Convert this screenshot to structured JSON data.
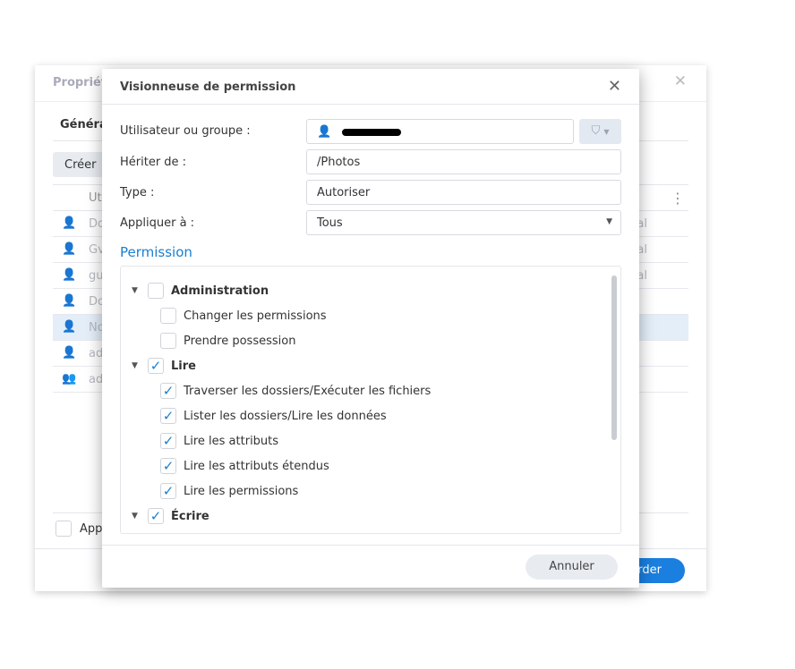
{
  "background_window": {
    "title": "Propriét",
    "tab": "Généra",
    "create_button": "Créer",
    "column_header": "Ut",
    "rows": [
      {
        "name": "Do",
        "right": "al",
        "icon": "user"
      },
      {
        "name": "Gv",
        "right": "al",
        "icon": "user"
      },
      {
        "name": "gu",
        "right": "al",
        "icon": "user"
      },
      {
        "name": "Do",
        "right": "",
        "icon": "user"
      },
      {
        "name": "No",
        "right": "",
        "icon": "user"
      },
      {
        "name": "ad",
        "right": "",
        "icon": "user"
      },
      {
        "name": "ad",
        "right": "",
        "icon": "group"
      }
    ],
    "apply_checkbox_label": "App",
    "save_button": "rder"
  },
  "dialog": {
    "title": "Visionneuse de permission",
    "fields": {
      "user_label": "Utilisateur ou groupe :",
      "inherit_label": "Hériter de :",
      "inherit_value": "/Photos",
      "type_label": "Type :",
      "type_value": "Autoriser",
      "apply_label": "Appliquer à :",
      "apply_value": "Tous"
    },
    "section": "Permission",
    "permissions": [
      {
        "label": "Administration",
        "group": true,
        "checked": false
      },
      {
        "label": "Changer les permissions",
        "group": false,
        "checked": false
      },
      {
        "label": "Prendre possession",
        "group": false,
        "checked": false
      },
      {
        "label": "Lire",
        "group": true,
        "checked": true
      },
      {
        "label": "Traverser les dossiers/Exécuter les fichiers",
        "group": false,
        "checked": true
      },
      {
        "label": "Lister les dossiers/Lire les données",
        "group": false,
        "checked": true
      },
      {
        "label": "Lire les attributs",
        "group": false,
        "checked": true
      },
      {
        "label": "Lire les attributs étendus",
        "group": false,
        "checked": true
      },
      {
        "label": "Lire les permissions",
        "group": false,
        "checked": true
      },
      {
        "label": "Écrire",
        "group": true,
        "checked": true
      }
    ],
    "cancel_button": "Annuler"
  },
  "colors": {
    "accent": "#1a7fcf",
    "selected_row": "#e3eef9"
  }
}
